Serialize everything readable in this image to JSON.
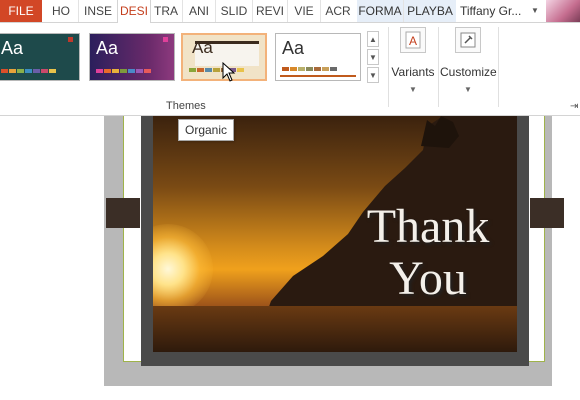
{
  "tabs": [
    {
      "label": "FILE"
    },
    {
      "label": "HO"
    },
    {
      "label": "INSE"
    },
    {
      "label": "DESI"
    },
    {
      "label": "TRA"
    },
    {
      "label": "ANI"
    },
    {
      "label": "SLID"
    },
    {
      "label": "REVI"
    },
    {
      "label": "VIE"
    },
    {
      "label": "ACR"
    },
    {
      "label": "FORMA"
    },
    {
      "label": "PLAYBA"
    }
  ],
  "user": {
    "name": "Tiffany Gr..."
  },
  "ribbon": {
    "themes_group_label": "Themes",
    "theme_sample_text": "Aa",
    "variants_label": "Variants",
    "customize_label": "Customize"
  },
  "tooltip": {
    "text": "Organic"
  },
  "slide": {
    "text_line1": "Thank",
    "text_line2": "You"
  },
  "colors": {
    "file_tab": "#d24726",
    "active_tab_text": "#c43e1c",
    "contextual_tab_bg": "#e6eef8"
  }
}
